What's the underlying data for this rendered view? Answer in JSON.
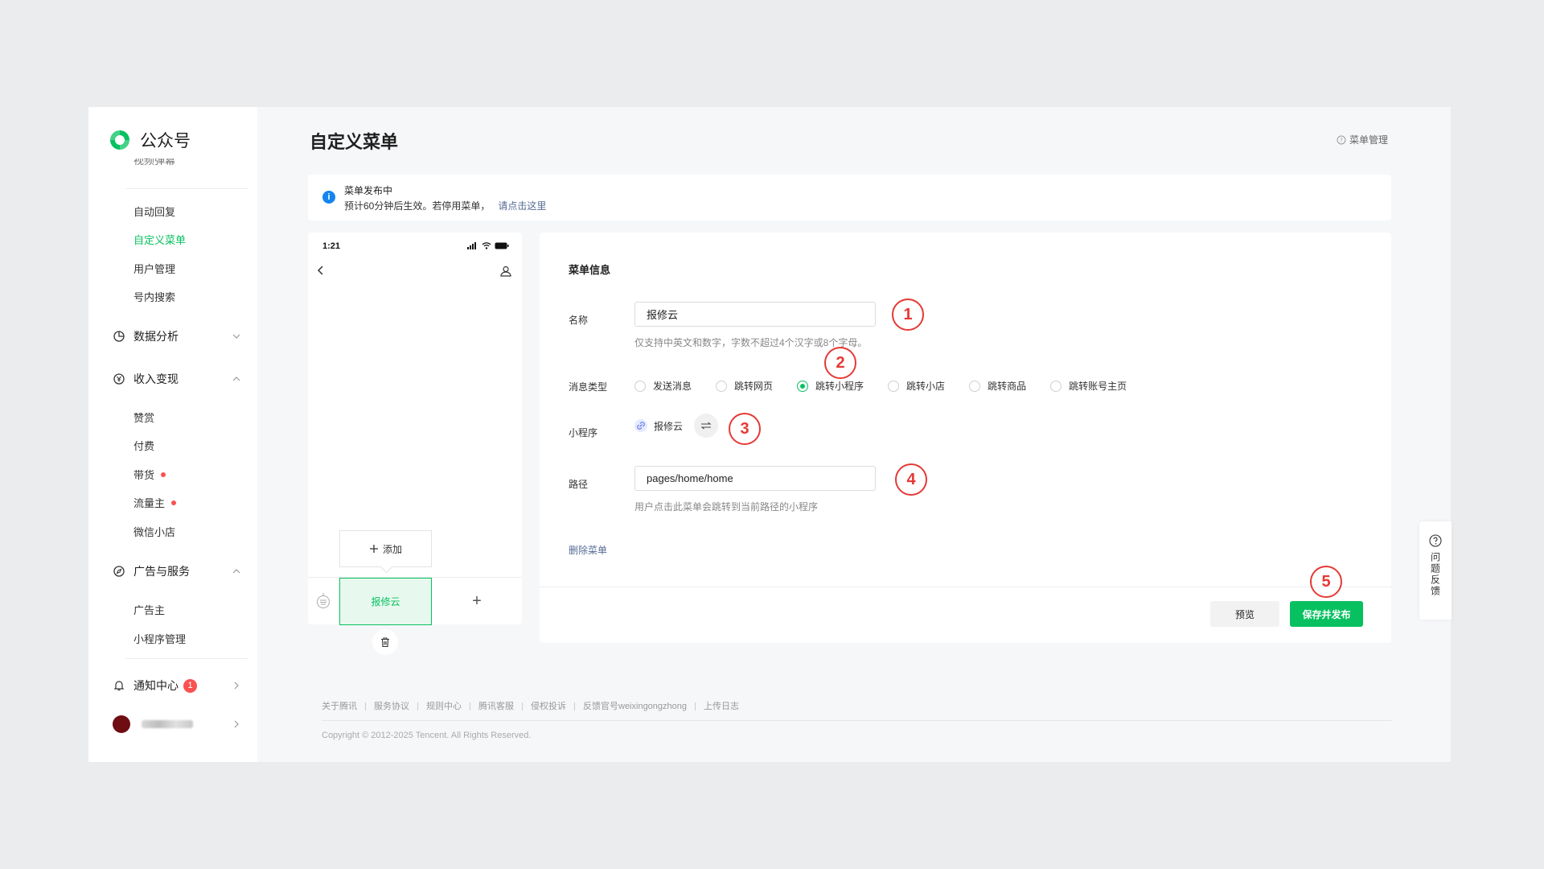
{
  "brand": {
    "name": "公众号",
    "color": "#07c160"
  },
  "sidebar": {
    "cut_item": "视频弹幕",
    "items_top": [
      {
        "label": "自动回复",
        "active": false
      },
      {
        "label": "自定义菜单",
        "active": true
      },
      {
        "label": "用户管理",
        "active": false
      },
      {
        "label": "号内搜索",
        "active": false
      }
    ],
    "group_data": {
      "label": "数据分析",
      "icon": "pie-chart-icon",
      "expanded": false
    },
    "group_income": {
      "label": "收入变现",
      "icon": "coin-icon",
      "expanded": true
    },
    "income_items": [
      {
        "label": "赞赏",
        "dot": false
      },
      {
        "label": "付费",
        "dot": false
      },
      {
        "label": "带货",
        "dot": true
      },
      {
        "label": "流量主",
        "dot": true
      },
      {
        "label": "微信小店",
        "dot": false
      }
    ],
    "group_ads": {
      "label": "广告与服务",
      "icon": "compass-icon",
      "expanded": true
    },
    "ads_items": [
      {
        "label": "广告主"
      },
      {
        "label": "小程序管理"
      }
    ],
    "notify": {
      "label": "通知中心",
      "badge": "1"
    }
  },
  "header": {
    "title": "自定义菜单",
    "help": "菜单管理"
  },
  "notice": {
    "title": "菜单发布中",
    "desc": "预计60分钟后生效。若停用菜单，",
    "link": "请点击这里"
  },
  "phone": {
    "time": "1:21",
    "add_label": "添加",
    "menu_item": "报修云",
    "add_symbol": "+"
  },
  "form": {
    "section_title": "菜单信息",
    "name_label": "名称",
    "name_value": "报修云",
    "name_hint": "仅支持中英文和数字，字数不超过4个汉字或8个字母。",
    "type_label": "消息类型",
    "types": [
      {
        "label": "发送消息",
        "checked": false
      },
      {
        "label": "跳转网页",
        "checked": false
      },
      {
        "label": "跳转小程序",
        "checked": true
      },
      {
        "label": "跳转小店",
        "checked": false
      },
      {
        "label": "跳转商品",
        "checked": false
      },
      {
        "label": "跳转账号主页",
        "checked": false
      }
    ],
    "miniapp_label": "小程序",
    "miniapp_value": "报修云",
    "path_label": "路径",
    "path_value": "pages/home/home",
    "path_hint": "用户点击此菜单会跳转到当前路径的小程序",
    "delete": "删除菜单",
    "preview_btn": "预览",
    "save_btn": "保存并发布"
  },
  "annotations": [
    "1",
    "2",
    "3",
    "4",
    "5"
  ],
  "footer": {
    "links": [
      "关于腾讯",
      "服务协议",
      "规则中心",
      "腾讯客服",
      "侵权投诉",
      "反馈官号weixingongzhong",
      "上传日志"
    ],
    "copyright": "Copyright © 2012-2025 Tencent. All Rights Reserved."
  },
  "feedback": {
    "label": "问题反馈"
  },
  "colors": {
    "accent": "#07c160",
    "link": "#576b95",
    "annotation": "#e53935",
    "info": "#1485ee",
    "alert": "#fa5151"
  }
}
